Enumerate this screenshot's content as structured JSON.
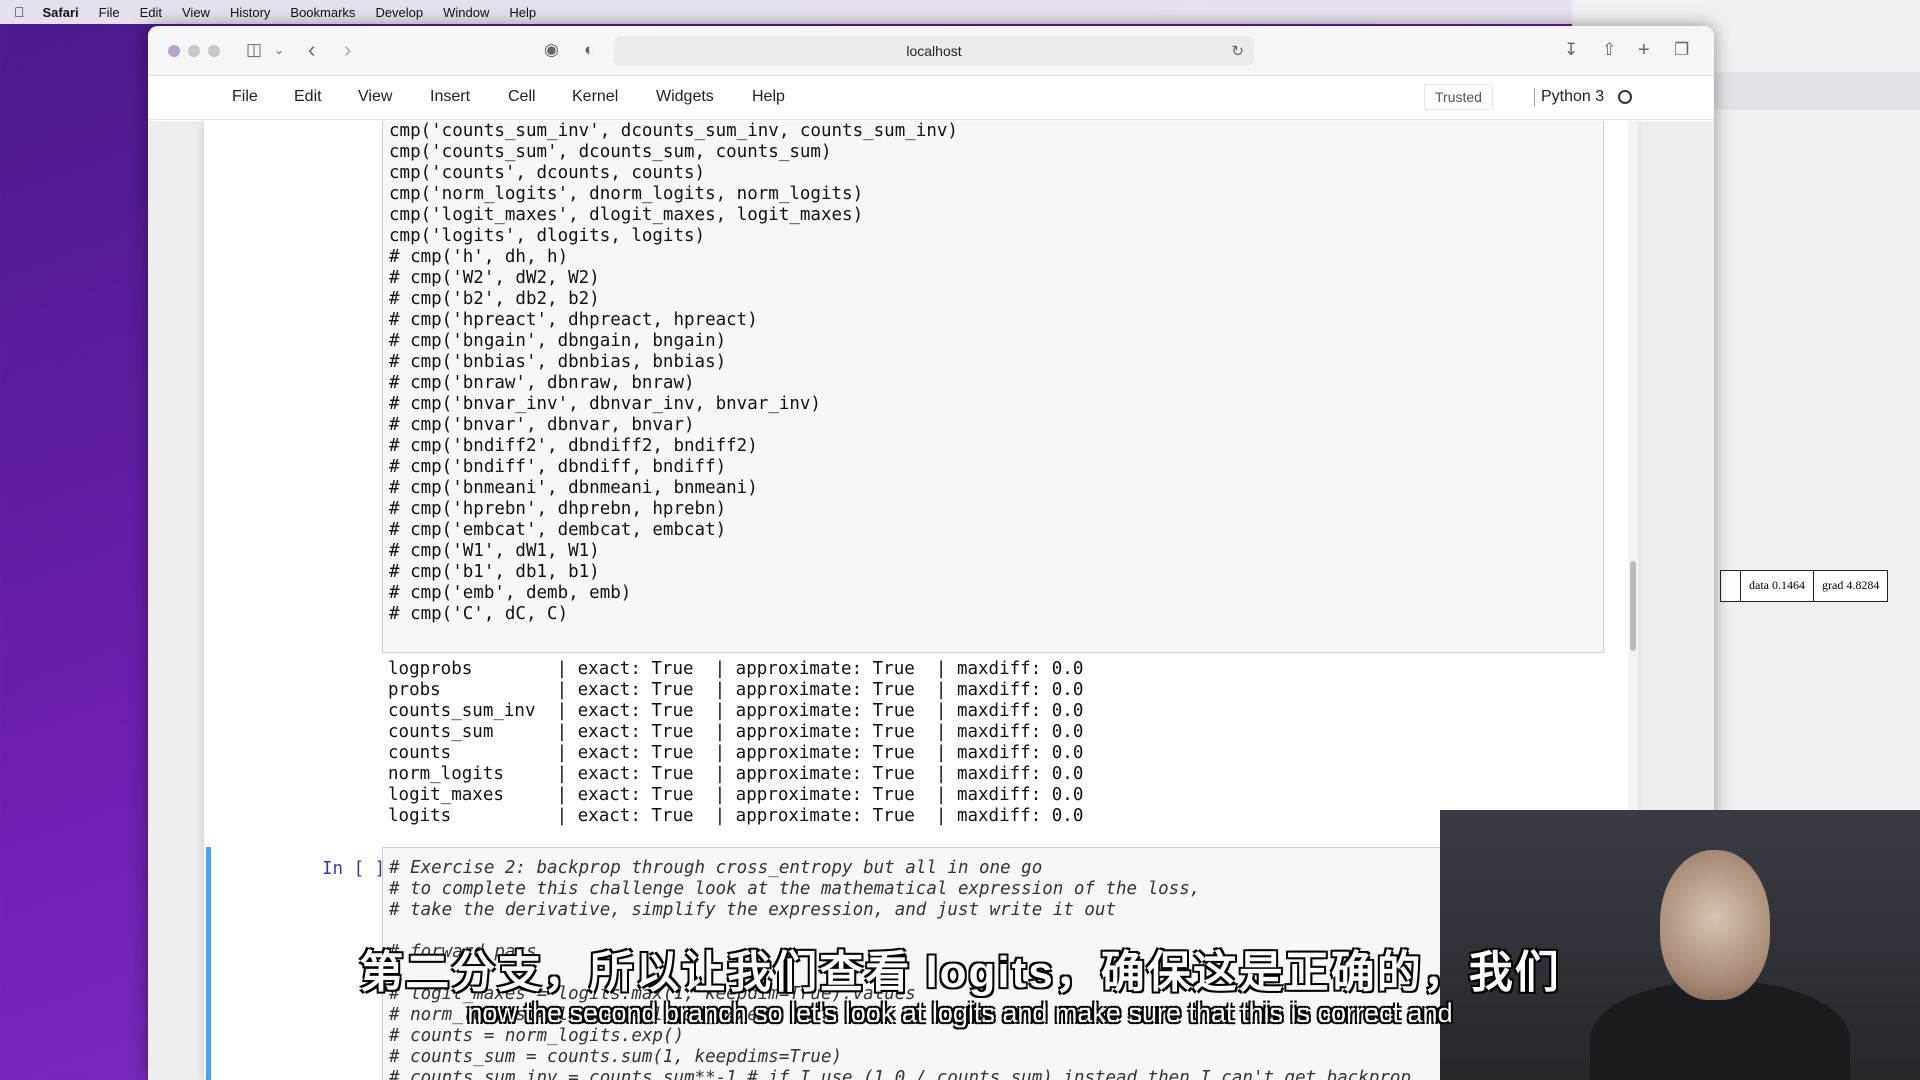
{
  "menubar": {
    "app": "Safari",
    "items": [
      "File",
      "Edit",
      "View",
      "History",
      "Bookmarks",
      "Develop",
      "Window",
      "Help"
    ]
  },
  "browser": {
    "url": "localhost"
  },
  "jupyter": {
    "menu": [
      "File",
      "Edit",
      "View",
      "Insert",
      "Cell",
      "Kernel",
      "Widgets",
      "Help"
    ],
    "trusted": "Trusted",
    "kernel": "Python 3"
  },
  "cell1": {
    "lines": [
      "cmp('counts_sum_inv', dcounts_sum_inv, counts_sum_inv)",
      "cmp('counts_sum', dcounts_sum, counts_sum)",
      "cmp('counts', dcounts, counts)",
      "cmp('norm_logits', dnorm_logits, norm_logits)",
      "cmp('logit_maxes', dlogit_maxes, logit_maxes)",
      "cmp('logits', dlogits, logits)",
      "# cmp('h', dh, h)",
      "# cmp('W2', dW2, W2)",
      "# cmp('b2', db2, b2)",
      "# cmp('hpreact', dhpreact, hpreact)",
      "# cmp('bngain', dbngain, bngain)",
      "# cmp('bnbias', dbnbias, bnbias)",
      "# cmp('bnraw', dbnraw, bnraw)",
      "# cmp('bnvar_inv', dbnvar_inv, bnvar_inv)",
      "# cmp('bnvar', dbnvar, bnvar)",
      "# cmp('bndiff2', dbndiff2, bndiff2)",
      "# cmp('bndiff', dbndiff, bndiff)",
      "# cmp('bnmeani', dbnmeani, bnmeani)",
      "# cmp('hprebn', dhprebn, hprebn)",
      "# cmp('embcat', dembcat, embcat)",
      "# cmp('W1', dW1, W1)",
      "# cmp('b1', db1, b1)",
      "# cmp('emb', demb, emb)",
      "# cmp('C', dC, C)"
    ]
  },
  "output1": {
    "lines": [
      "logprobs        | exact: True  | approximate: True  | maxdiff: 0.0",
      "probs           | exact: True  | approximate: True  | maxdiff: 0.0",
      "counts_sum_inv  | exact: True  | approximate: True  | maxdiff: 0.0",
      "counts_sum      | exact: True  | approximate: True  | maxdiff: 0.0",
      "counts          | exact: True  | approximate: True  | maxdiff: 0.0",
      "norm_logits     | exact: True  | approximate: True  | maxdiff: 0.0",
      "logit_maxes     | exact: True  | approximate: True  | maxdiff: 0.0",
      "logits          | exact: True  | approximate: True  | maxdiff: 0.0"
    ]
  },
  "cell2": {
    "prompt": "In [ ]:",
    "lines": [
      "# Exercise 2: backprop through cross_entropy but all in one go",
      "# to complete this challenge look at the mathematical expression of the loss,",
      "# take the derivative, simplify the expression, and just write it out",
      "",
      "# forward pass",
      "",
      "# logit_maxes = logits.max(1, keepdim=True).values",
      "# norm_logits = logits - logit_maxes",
      "# counts = norm_logits.exp()",
      "# counts_sum = counts.sum(1, keepdims=True)",
      "# counts_sum_inv = counts_sum**-1 # if I use (1.0 / counts_sum) instead then I can't get backprop"
    ]
  },
  "side_node": {
    "data": "data 0.1464",
    "grad": "grad 4.8284"
  },
  "subtitles": {
    "chinese": "第二分支，所以让我们查看 logits，确保这是正确的，我们",
    "english": "now the second branch so let's look at logits and make sure that this is correct and"
  }
}
